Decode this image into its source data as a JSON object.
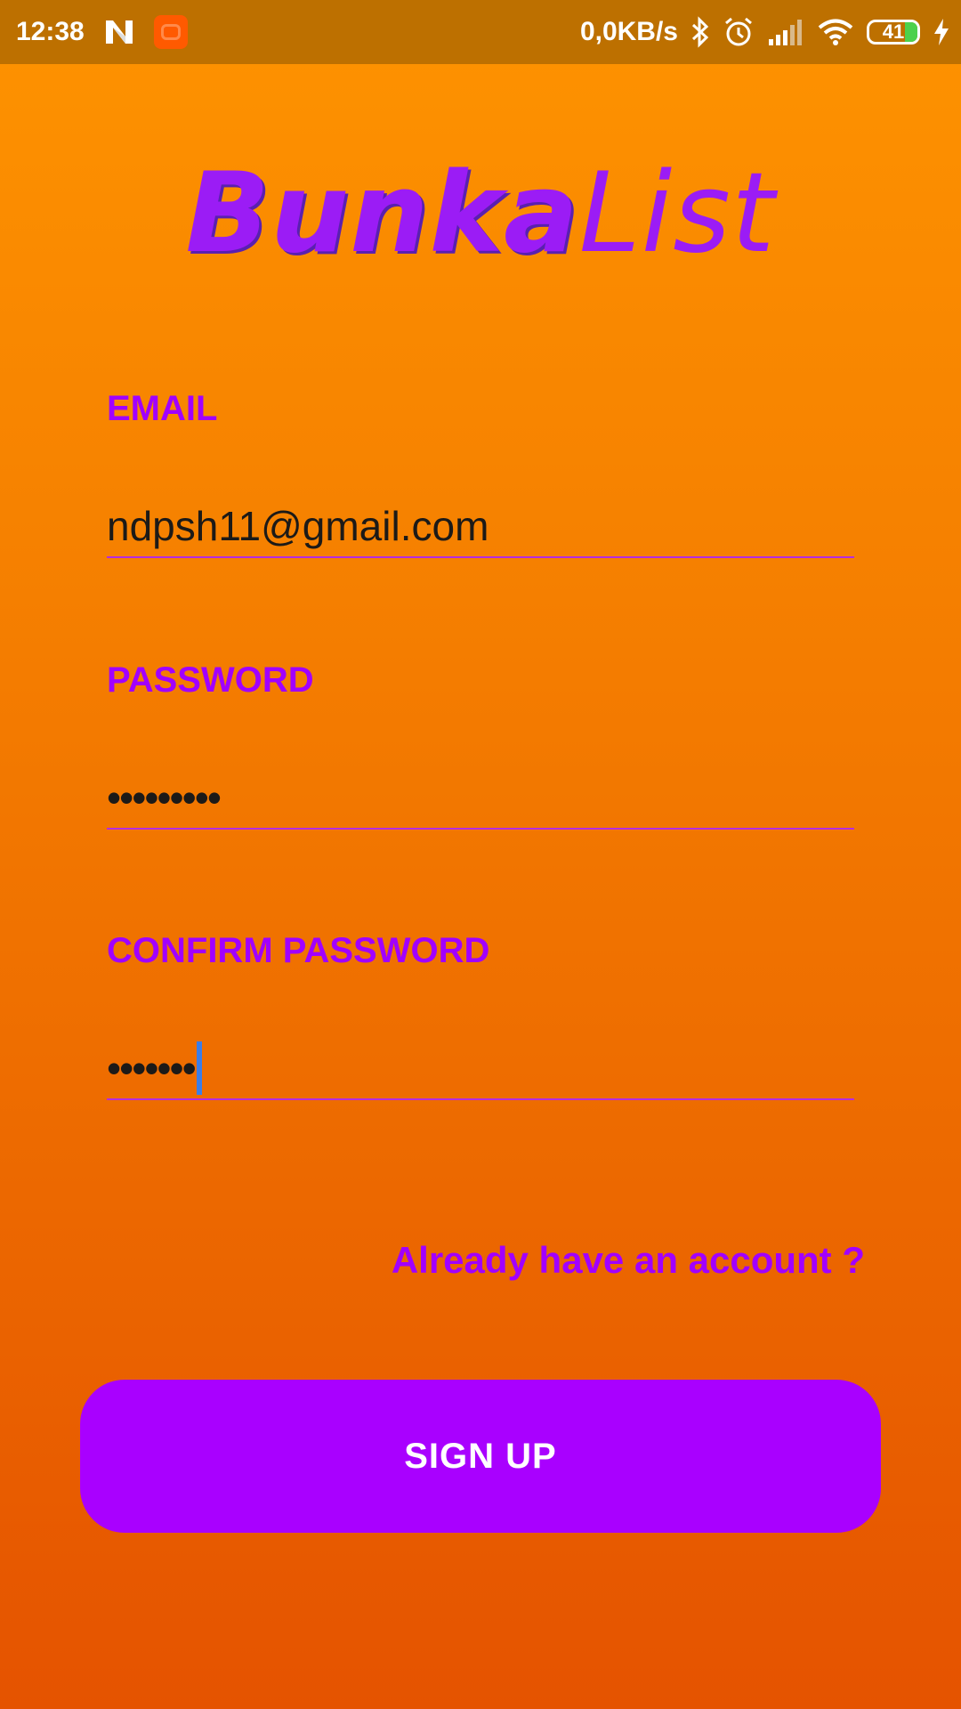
{
  "status_bar": {
    "time": "12:38",
    "network_speed": "0,0KB/s",
    "battery_level": "41",
    "icons": [
      "notification-n-icon",
      "app-icon",
      "bluetooth-icon",
      "alarm-icon",
      "signal-icon",
      "wifi-icon",
      "battery-icon",
      "charging-icon"
    ]
  },
  "app": {
    "logo_bold": "Bunka",
    "logo_light": "List"
  },
  "form": {
    "email_label": "EMAIL",
    "email_value": "ndpsh11@gmail.com",
    "password_label": "PASSWORD",
    "password_value": "•••••••••",
    "confirm_label": "CONFIRM PASSWORD",
    "confirm_value": "•••••••",
    "login_link": "Already have an account ?",
    "signup_button": "SIGN UP"
  },
  "colors": {
    "accent": "#a900ff",
    "status_bar": "#bd7000",
    "background_top": "#fe9300",
    "background_bottom": "#e55300"
  }
}
